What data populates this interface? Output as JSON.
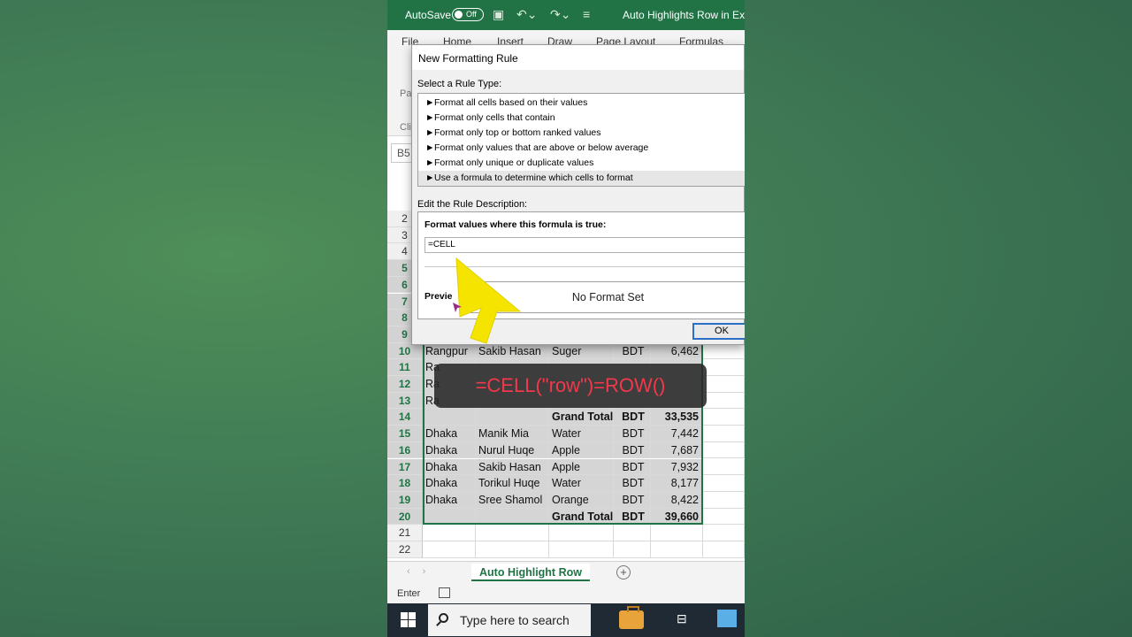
{
  "titlebar": {
    "autosave_label": "AutoSave",
    "toggle_state": "Off",
    "doc_title": "Auto Highlights Row in Exce"
  },
  "ribbon": {
    "tabs": [
      "File",
      "Home",
      "Insert",
      "Draw",
      "Page Layout",
      "Formulas"
    ],
    "frag1": "Pa",
    "frag2": "Cli"
  },
  "namebox": "B5",
  "dialog": {
    "title": "New Formatting Rule",
    "select_rule_label": "Select a Rule Type:",
    "rule_types": [
      "Format all cells based on their values",
      "Format only cells that contain",
      "Format only top or bottom ranked values",
      "Format only values that are above or below average",
      "Format only unique or duplicate values",
      "Use a formula to determine which cells to format"
    ],
    "edit_desc_label": "Edit the Rule Description:",
    "formula_label": "Format values where this formula is true:",
    "formula_value": "=CELL",
    "preview_label": "Previe",
    "preview_text": "No Format Set",
    "ok_label": "OK"
  },
  "grid": {
    "rows": [
      {
        "n": "2",
        "a": "",
        "b": "",
        "c": "",
        "d": "",
        "e": ""
      },
      {
        "n": "3",
        "a": "",
        "b": "",
        "c": "",
        "d": "",
        "e": ""
      },
      {
        "n": "4",
        "a": "",
        "b": "",
        "c": "",
        "d": "",
        "e": ""
      },
      {
        "n": "5",
        "a": "",
        "b": "",
        "c": "",
        "d": "",
        "e": ""
      },
      {
        "n": "6",
        "a": "",
        "b": "",
        "c": "",
        "d": "",
        "e": ""
      },
      {
        "n": "7",
        "a": "",
        "b": "",
        "c": "",
        "d": "",
        "e": ""
      },
      {
        "n": "8",
        "a": "",
        "b": "",
        "c": "",
        "d": "",
        "e": ""
      },
      {
        "n": "9",
        "a": "",
        "b": "",
        "c": "",
        "d": "",
        "e": ""
      },
      {
        "n": "10",
        "a": "Rangpur",
        "b": "Sakib Hasan",
        "c": "Suger",
        "d": "BDT",
        "e": "6,462"
      },
      {
        "n": "11",
        "a": "Ra",
        "b": "",
        "c": "",
        "d": "",
        "e": ""
      },
      {
        "n": "12",
        "a": "Ra",
        "b": "",
        "c": "",
        "d": "",
        "e": ""
      },
      {
        "n": "13",
        "a": "Ra",
        "b": "",
        "c": "",
        "d": "",
        "e": ""
      },
      {
        "n": "14",
        "a": "",
        "b": "",
        "c": "Grand Total",
        "d": "BDT",
        "e": "33,535"
      },
      {
        "n": "15",
        "a": "Dhaka",
        "b": "Manik Mia",
        "c": "Water",
        "d": "BDT",
        "e": "7,442"
      },
      {
        "n": "16",
        "a": "Dhaka",
        "b": "Nurul Huqe",
        "c": "Apple",
        "d": "BDT",
        "e": "7,687"
      },
      {
        "n": "17",
        "a": "Dhaka",
        "b": "Sakib Hasan",
        "c": "Apple",
        "d": "BDT",
        "e": "7,932"
      },
      {
        "n": "18",
        "a": "Dhaka",
        "b": "Torikul Huqe",
        "c": "Water",
        "d": "BDT",
        "e": "8,177"
      },
      {
        "n": "19",
        "a": "Dhaka",
        "b": "Sree Shamol",
        "c": "Orange",
        "d": "BDT",
        "e": "8,422"
      },
      {
        "n": "20",
        "a": "",
        "b": "",
        "c": "Grand Total",
        "d": "BDT",
        "e": "39,660"
      },
      {
        "n": "21",
        "a": "",
        "b": "",
        "c": "",
        "d": "",
        "e": ""
      },
      {
        "n": "22",
        "a": "",
        "b": "",
        "c": "",
        "d": "",
        "e": ""
      }
    ]
  },
  "sheet_tab": "Auto Highlight Row",
  "status": "Enter",
  "taskbar": {
    "search_placeholder": "Type here to search"
  },
  "caption": "=CELL(\"row\")=ROW()",
  "colors": {
    "excel_green": "#217346",
    "caption_red": "#f2384b",
    "arrow_yellow": "#f5e400"
  }
}
